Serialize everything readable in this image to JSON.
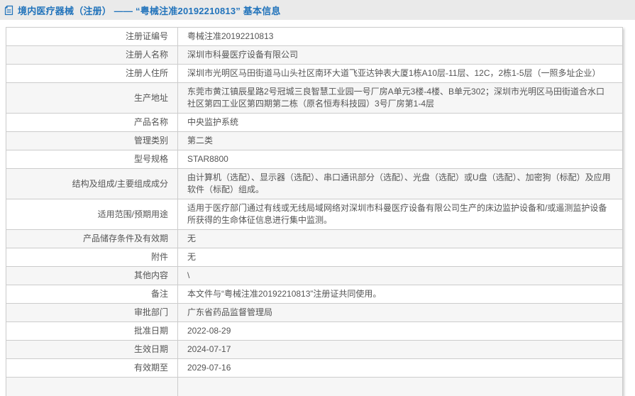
{
  "colors": {
    "accent_blue": "#2173bb",
    "topbar_bg": "#eaeaea",
    "row_alt_bg": "#f6f6f6",
    "border": "#cccccc"
  },
  "header": {
    "title": "境内医疗器械（注册） —— “粤械注准20192210813” 基本信息"
  },
  "table": {
    "rows": [
      {
        "label": "注册证编号",
        "value": "粤械注准20192210813"
      },
      {
        "label": "注册人名称",
        "value": "深圳市科曼医疗设备有限公司"
      },
      {
        "label": "注册人住所",
        "value": "深圳市光明区马田街道马山头社区南环大道飞亚达钟表大厦1栋A10层-11层、12C，2栋1-5层（一照多址企业）"
      },
      {
        "label": "生产地址",
        "value": "东莞市黄江镇辰星路2号冠城三良智慧工业园一号厂房A单元3楼-4楼、B单元302；深圳市光明区马田街道合水口社区第四工业区第四期第二栋（原名恒寿科技园）3号厂房第1-4层"
      },
      {
        "label": "产品名称",
        "value": "中央监护系统"
      },
      {
        "label": "管理类别",
        "value": "第二类"
      },
      {
        "label": "型号规格",
        "value": "STAR8800"
      },
      {
        "label": "结构及组成/主要组成成分",
        "value": "由计算机（选配）、显示器（选配）、串口通讯部分（选配）、光盘（选配）或U盘（选配）、加密狗（标配）及应用软件（标配）组成。"
      },
      {
        "label": "适用范围/预期用途",
        "value": "适用于医疗部门通过有线或无线局域网络对深圳市科曼医疗设备有限公司生产的床边监护设备和/或遥测监护设备所获得的生命体征信息进行集中监测。"
      },
      {
        "label": "产品储存条件及有效期",
        "value": "无"
      },
      {
        "label": "附件",
        "value": "无"
      },
      {
        "label": "其他内容",
        "value": "\\"
      },
      {
        "label": "备注",
        "value": "本文件与“粤械注准20192210813”注册证共同使用。"
      },
      {
        "label": "审批部门",
        "value": "广东省药品监督管理局"
      },
      {
        "label": "批准日期",
        "value": "2022-08-29"
      },
      {
        "label": "生效日期",
        "value": "2024-07-17"
      },
      {
        "label": "有效期至",
        "value": "2029-07-16"
      }
    ]
  }
}
